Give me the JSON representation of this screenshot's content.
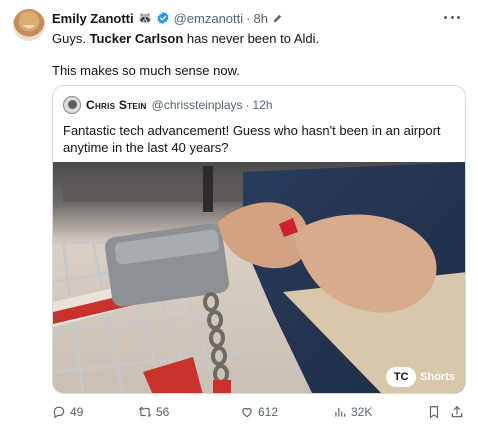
{
  "author": {
    "name": "Emily Zanotti",
    "emoji": "🦝",
    "handle": "@emzanotti",
    "separator": "·",
    "time": "8h"
  },
  "tweet": {
    "line1_pre": "Guys. ",
    "line1_bold": "Tucker Carlson",
    "line1_post": " has never been to Aldi.",
    "line2": "This makes so much sense now."
  },
  "quoted": {
    "name": "Chris Stein",
    "handle": "@chrissteinplays",
    "separator": "·",
    "time": "12h",
    "text": "Fantastic tech advancement! Guess who hasn't been in an airport anytime in the last 40 years?",
    "media": {
      "badge_logo": "TC",
      "badge_label": "Shorts"
    }
  },
  "actions": {
    "replies": "49",
    "reposts": "56",
    "likes": "612",
    "views": "32K"
  },
  "colors": {
    "text": "#0f1419",
    "secondary": "#536471",
    "verified": "#1d9bf0",
    "border": "#cfd9de"
  },
  "icons": [
    "verified-badge-icon",
    "edit-pencil-icon",
    "more-icon",
    "reply-icon",
    "repost-icon",
    "like-icon",
    "views-icon",
    "bookmark-icon",
    "share-icon"
  ]
}
